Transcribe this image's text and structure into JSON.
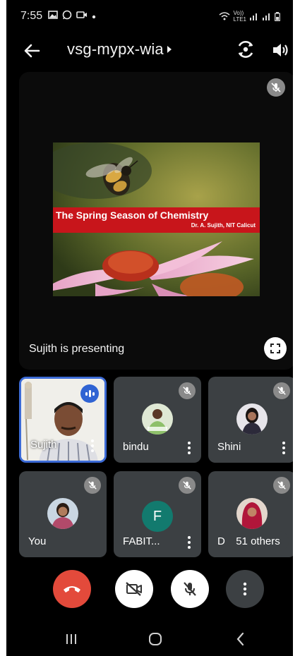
{
  "status_bar": {
    "time": "7:55",
    "network": "Vo))",
    "network_sub": "LTE1"
  },
  "header": {
    "meeting_code": "vsg-mypx-wia"
  },
  "presentation": {
    "slide_title": "The Spring Season of Chemistry",
    "slide_author": "Dr. A. Sujith, NIT Calicut",
    "presenting_label": "Sujith is presenting"
  },
  "participants": [
    {
      "name": "Sujith",
      "muted": false,
      "speaking": true
    },
    {
      "name": "bindu",
      "muted": true
    },
    {
      "name": "Shini",
      "muted": true
    },
    {
      "name": "You",
      "muted": true
    },
    {
      "name": "FABIT...",
      "muted": true,
      "avatar_letter": "F"
    },
    {
      "name": "D",
      "muted": true
    }
  ],
  "others_count_label": "51 others",
  "controls": [
    "end-call",
    "camera-off",
    "mic-off",
    "more-options"
  ],
  "colors": {
    "end_call": "#e34a3b",
    "active_speaker": "#2f63d3",
    "tile_bg": "#3c4043",
    "avatar_f": "#127a6e"
  }
}
